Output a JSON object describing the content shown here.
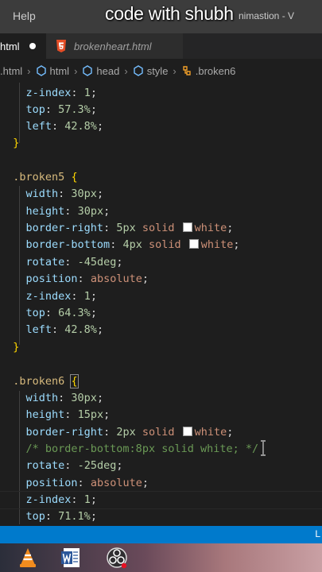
{
  "menubar": {
    "help_label": "Help",
    "window_title": "nimastion - V"
  },
  "overlay": {
    "text": "code with shubh"
  },
  "tabs": [
    {
      "label": "html",
      "dirty": true
    },
    {
      "label": "brokenheart.html"
    }
  ],
  "breadcrumb": [
    ".html",
    "html",
    "head",
    "style",
    ".broken6"
  ],
  "code": {
    "l1": {
      "prop": "z-index",
      "value": "1"
    },
    "l2": {
      "prop": "top",
      "value": "57.3%"
    },
    "l3": {
      "prop": "left",
      "value": "42.8%"
    },
    "l4": {
      "close": "}"
    },
    "l6": {
      "selector": ".broken5",
      "open": "{"
    },
    "l7": {
      "prop": "width",
      "value": "30px"
    },
    "l8": {
      "prop": "height",
      "value": "30px"
    },
    "l9": {
      "prop": "border-right",
      "v1": "5px",
      "v2": "solid",
      "v3": "white"
    },
    "l10": {
      "prop": "border-bottom",
      "v1": "4px",
      "v2": "solid",
      "v3": "white"
    },
    "l11": {
      "prop": "rotate",
      "value": "-45deg"
    },
    "l12": {
      "prop": "position",
      "value": "absolute"
    },
    "l13": {
      "prop": "z-index",
      "value": "1"
    },
    "l14": {
      "prop": "top",
      "value": "64.3%"
    },
    "l15": {
      "prop": "left",
      "value": "42.8%"
    },
    "l16": {
      "close": "}"
    },
    "l18": {
      "selector": ".broken6",
      "open": "{"
    },
    "l19": {
      "prop": "width",
      "value": "30px"
    },
    "l20": {
      "prop": "height",
      "value": "15px"
    },
    "l21": {
      "prop": "border-right",
      "v1": "2px",
      "v2": "solid",
      "v3": "white"
    },
    "l22": {
      "comment": "/* border-bottom:8px solid white; */"
    },
    "l23": {
      "prop": "rotate",
      "value": "-25deg"
    },
    "l24": {
      "prop": "position",
      "value": "absolute"
    },
    "l25": {
      "prop": "z-index",
      "value": "1"
    },
    "l26": {
      "prop": "top",
      "value": "71.1%"
    }
  },
  "statusbar": {
    "text": "L"
  },
  "taskbar": {
    "icons": [
      "vlc-icon",
      "word-icon",
      "obs-icon"
    ]
  },
  "colors": {
    "menubar": "#3c3c3c",
    "editor_bg": "#1e1e1e",
    "statusbar": "#007acc",
    "selector": "#d7ba7d",
    "property": "#9cdcfe",
    "number": "#b5cea8",
    "keyword": "#ce9178",
    "comment": "#6a9955"
  }
}
